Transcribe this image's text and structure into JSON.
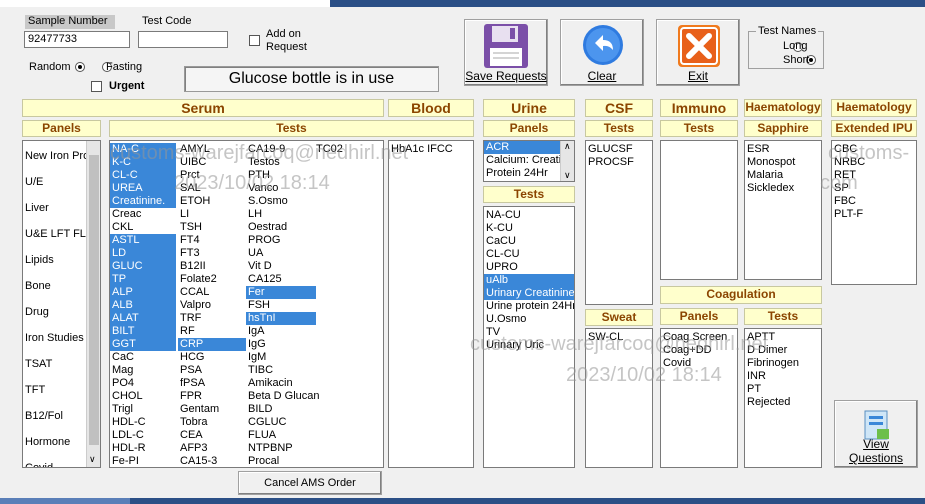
{
  "form": {
    "sample_number_label": "Sample Number",
    "sample_number_value": "92477733",
    "test_code_label": "Test Code",
    "test_code_value": "",
    "add_on_request_label": "Add on Request",
    "random_label": "Random",
    "fasting_label": "Fasting",
    "urgent_label": "Urgent",
    "message": "Glucose bottle is in use",
    "test_names_label": "Test Names",
    "long_label": "Long",
    "short_label": "Short"
  },
  "buttons": {
    "save": "Save Requests",
    "clear": "Clear",
    "exit": "Exit",
    "cancel_ams": "Cancel AMS Order",
    "view_questions": "View Questions"
  },
  "sections": {
    "serum": "Serum",
    "blood": "Blood",
    "urine": "Urine",
    "csf": "CSF",
    "immuno": "Immuno",
    "haematology1": "Haematology",
    "haematology2": "Haematology",
    "panels": "Panels",
    "tests": "Tests",
    "urine_panels": "Panels",
    "urine_tests": "Tests",
    "csf_tests": "Tests",
    "immuno_tests": "Tests",
    "sapphire": "Sapphire",
    "extended_ipu": "Extended IPU",
    "sweat": "Sweat",
    "coagulation": "Coagulation",
    "coag_panels": "Panels",
    "coag_tests": "Tests"
  },
  "serum_panels": [
    "New Iron Pro",
    "U/E",
    "Liver",
    "U&E LFT FLI",
    "Lipids",
    "Bone",
    "Drug",
    "Iron Studies",
    "TSAT",
    "TFT",
    "B12/Fol",
    "Hormone",
    "Covid"
  ],
  "serum_col1": [
    "NA-C",
    "K-C",
    "CL-C",
    "UREA",
    "Creatinine.",
    "Creac",
    "CKL",
    "ASTL",
    "LD",
    "GLUC",
    "TP",
    "ALP",
    "ALB",
    "ALAT",
    "BILT",
    "GGT",
    "CaC",
    "Mag",
    "PO4",
    "CHOL",
    "Trigl",
    "HDL-C",
    "LDL-C",
    "HDL-R",
    "Fe-PI"
  ],
  "serum_col2": [
    "AMYL",
    "UIBC",
    "Prct",
    "SAL",
    "ETOH",
    "LI",
    "TSH",
    "FT4",
    "FT3",
    "B12II",
    "Folate2",
    "CCAL",
    "Valpro",
    "TRF",
    "RF",
    "CRP",
    "HCG",
    "PSA",
    "fPSA",
    "FPR",
    "Gentam",
    "Tobra",
    "CEA",
    "AFP3",
    "CA15-3"
  ],
  "serum_col3": [
    "CA19-9",
    "Testos",
    "PTH",
    "Vanco",
    "S.Osmo",
    "LH",
    "Oestrad",
    "PROG",
    "UA",
    "Vit D",
    "CA125",
    "Fer",
    "FSH",
    "hsTnI",
    "IgA",
    "IgG",
    "IgM",
    "TIBC",
    "Amikacin",
    "Beta D Glucan",
    "BILD",
    "CGLUC",
    "FLUA",
    "NTPBNP",
    "Procal"
  ],
  "serum_col4": [
    "TC02"
  ],
  "blood_tests": [
    "HbA1c IFCC"
  ],
  "urine_panels": [
    "ACR",
    "Calcium: Creatinine",
    "Protein 24Hr"
  ],
  "urine_tests": [
    "NA-CU",
    "K-CU",
    "CaCU",
    "CL-CU",
    "UPRO",
    "uAlb",
    "Urinary Creatinine.",
    "Urine protein 24Hr",
    "U.Osmo",
    "TV",
    "Urinary Uric"
  ],
  "csf_tests": [
    "GLUCSF",
    "PROCSF"
  ],
  "sweat_tests": [
    "SW-CL"
  ],
  "sapphire_tests": [
    "ESR",
    "Monospot",
    "Malaria",
    "Sickledex"
  ],
  "extended_ipu_tests": [
    "CBC",
    "NRBC",
    "RET",
    "SP",
    "FBC",
    "PLT-F"
  ],
  "coag_panels": [
    "Coag Screen",
    "Coag+DD",
    "Covid"
  ],
  "coag_tests": [
    "APTT",
    "D Dimer",
    "Fibrinogen",
    "INR",
    "PT",
    "Rejected"
  ],
  "watermark": {
    "line1": "customs-warejfarcoq@nedhirl.net",
    "line2": "2023/10/02 18:14",
    "line3": "customs-warejfarcoq@nedhirl.net",
    "line4": "2023/10/02 18:14",
    "line5": "customs-",
    "line6": "com"
  },
  "colors": {
    "selection": "#3a87d8",
    "header_bg": "#ffffcc",
    "header_text": "#8b4500",
    "title_bar": "#2b4f86"
  }
}
